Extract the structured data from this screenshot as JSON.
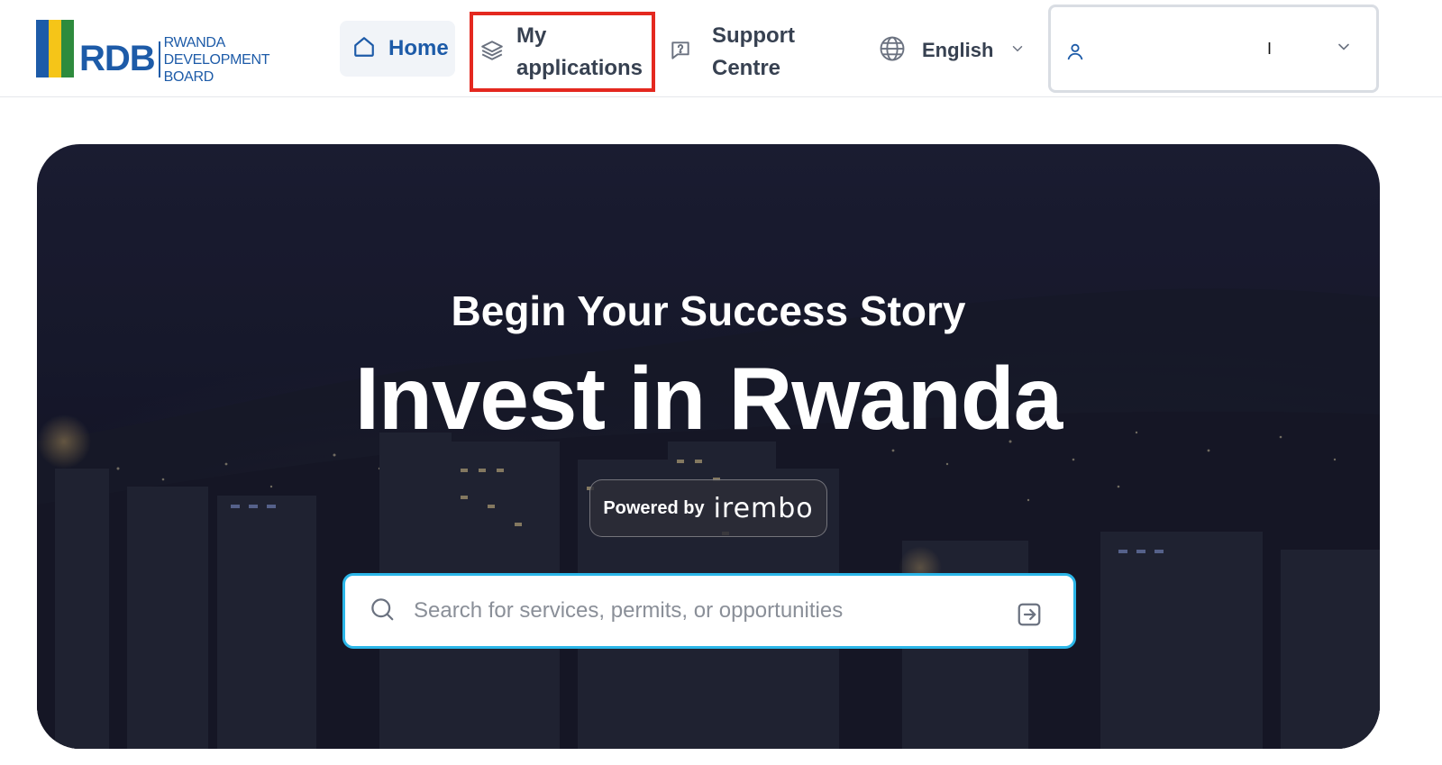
{
  "header": {
    "logo": {
      "abbr": "RDB",
      "line1": "RWANDA",
      "line2": "DEVELOPMENT BOARD",
      "bar_colors": [
        "#1d5ba8",
        "#f5c518",
        "#2e8b3d"
      ],
      "icon": "rdb-logo"
    },
    "nav": {
      "home": {
        "label": "Home",
        "icon": "home-icon",
        "active": true
      },
      "applications": {
        "label_line1": "My",
        "label_line2": "applications",
        "icon": "layers-icon",
        "highlighted": true
      },
      "support": {
        "label_line1": "Support",
        "label_line2": "Centre",
        "icon": "help-chat-icon"
      }
    },
    "language": {
      "selected": "English",
      "icon": "globe-icon",
      "dropdown_icon": "chevron-down-icon"
    },
    "user_menu": {
      "name": "I",
      "icon": "user-icon",
      "dropdown_icon": "chevron-down-icon"
    }
  },
  "hero": {
    "subtitle": "Begin Your Success Story",
    "title": "Invest in Rwanda",
    "powered_by": {
      "prefix": "Powered by",
      "brand": "irembo"
    },
    "search": {
      "placeholder": "Search for services, permits, or opportunities",
      "value": "",
      "icon": "search-icon",
      "submit_icon": "arrow-right-box-icon"
    }
  },
  "colors": {
    "brand_blue": "#1d5ba8",
    "highlight_red": "#e4281f",
    "search_border": "#2bb6e8"
  }
}
